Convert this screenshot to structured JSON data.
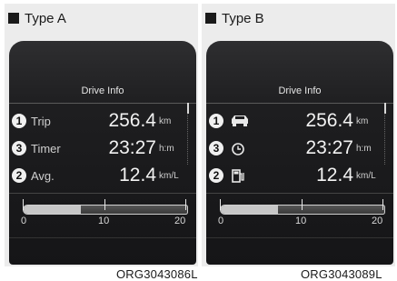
{
  "panels": [
    {
      "title": "Type A",
      "drive_info_title": "Drive Info",
      "rows": [
        {
          "badge": "1",
          "label": "Trip",
          "icon": "",
          "value": "256.4",
          "unit": "km"
        },
        {
          "badge": "3",
          "label": "Timer",
          "icon": "",
          "value": "23:27",
          "unit": "h:m"
        },
        {
          "badge": "2",
          "label": "Avg.",
          "icon": "",
          "value": "12.4",
          "unit": "km/L"
        }
      ],
      "gauge": {
        "ticks": [
          "0",
          "10",
          "20"
        ],
        "fill_fraction": 0.35
      },
      "caption": "ORG3043086L"
    },
    {
      "title": "Type B",
      "drive_info_title": "Drive Info",
      "rows": [
        {
          "badge": "1",
          "label": "",
          "icon": "car-icon",
          "value": "256.4",
          "unit": "km"
        },
        {
          "badge": "3",
          "label": "",
          "icon": "clock-icon",
          "value": "23:27",
          "unit": "h:m"
        },
        {
          "badge": "2",
          "label": "",
          "icon": "fuel-pump-icon",
          "value": "12.4",
          "unit": "km/L"
        }
      ],
      "gauge": {
        "ticks": [
          "0",
          "10",
          "20"
        ],
        "fill_fraction": 0.35
      },
      "caption": "ORG3043089L"
    }
  ],
  "colors": {
    "display_bg": "#1e1e20",
    "text": "#f2f2f2",
    "panel_bg": "#ececec"
  }
}
